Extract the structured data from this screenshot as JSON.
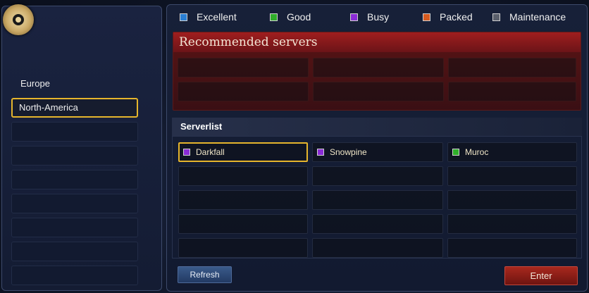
{
  "legend": [
    {
      "label": "Excellent",
      "color": "#2a7fd4"
    },
    {
      "label": "Good",
      "color": "#2fae2a"
    },
    {
      "label": "Busy",
      "color": "#8a2bd6"
    },
    {
      "label": "Packed",
      "color": "#d65a1f"
    },
    {
      "label": "Maintenance",
      "color": "#5a5f6b"
    }
  ],
  "regions": [
    {
      "label": "Europe",
      "selected": false
    },
    {
      "label": "North-America",
      "selected": true
    }
  ],
  "recommended": {
    "title": "Recommended servers"
  },
  "server_list": {
    "title": "Serverlist",
    "servers": [
      {
        "name": "Darkfall",
        "status_color": "#8a2bd6",
        "selected": true
      },
      {
        "name": "Snowpine",
        "status_color": "#8a2bd6",
        "selected": false
      },
      {
        "name": "Muroc",
        "status_color": "#2fae2a",
        "selected": false
      }
    ]
  },
  "buttons": {
    "refresh": "Refresh",
    "enter": "Enter"
  }
}
